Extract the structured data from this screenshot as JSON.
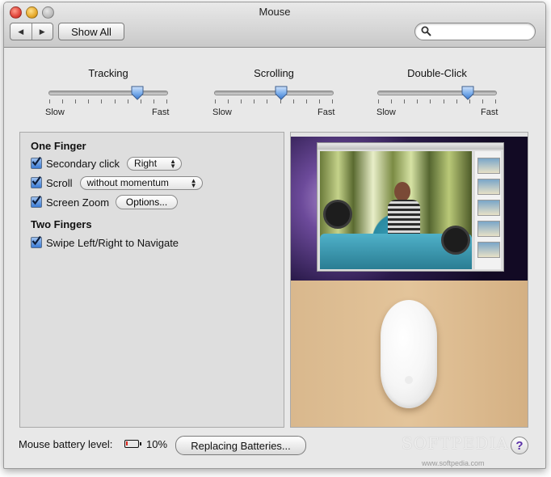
{
  "window": {
    "title": "Mouse"
  },
  "toolbar": {
    "back": "◀",
    "forward": "▶",
    "show_all": "Show All",
    "search_placeholder": ""
  },
  "sliders": [
    {
      "title": "Tracking",
      "min_label": "Slow",
      "max_label": "Fast",
      "ticks": 10,
      "value": 0.75
    },
    {
      "title": "Scrolling",
      "min_label": "Slow",
      "max_label": "Fast",
      "ticks": 10,
      "value": 0.57
    },
    {
      "title": "Double-Click",
      "min_label": "Slow",
      "max_label": "Fast",
      "ticks": 10,
      "value": 0.77
    }
  ],
  "one_finger": {
    "title": "One Finger",
    "secondary_click": {
      "label": "Secondary click",
      "checked": true,
      "value": "Right"
    },
    "scroll": {
      "label": "Scroll",
      "checked": true,
      "value": "without momentum"
    },
    "screen_zoom": {
      "label": "Screen Zoom",
      "checked": true,
      "button": "Options..."
    }
  },
  "two_fingers": {
    "title": "Two Fingers",
    "swipe": {
      "label": "Swipe Left/Right to Navigate",
      "checked": true
    }
  },
  "footer": {
    "battery_label": "Mouse battery level:",
    "battery_value": "10%",
    "battery_level": 0.1,
    "replace_button": "Replacing Batteries...",
    "help": "?"
  },
  "watermark": {
    "text": "SOFTPEDIA",
    "url": "www.softpedia.com"
  },
  "colors": {
    "accent": "#3b7bd5",
    "battery_low": "#d9261c",
    "help": "#5a2fa8"
  }
}
